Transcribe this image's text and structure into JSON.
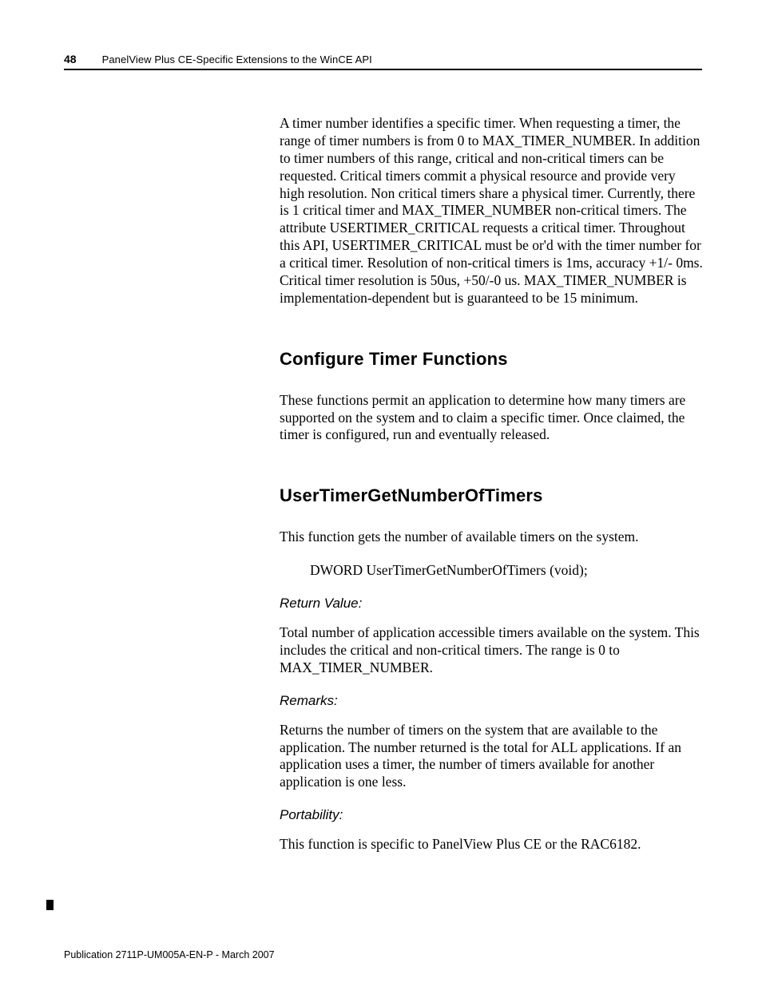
{
  "header": {
    "page_number": "48",
    "title": "PanelView Plus CE-Specific Extensions to the WinCE API"
  },
  "body": {
    "intro": "A timer number identifies a specific timer. When requesting a timer, the range of timer numbers is from 0 to MAX_TIMER_NUMBER. In addition to timer numbers of this range, critical and non-critical timers can be requested. Critical timers commit a physical resource and provide very high resolution. Non critical timers share a physical timer. Currently, there is 1 critical timer and MAX_TIMER_NUMBER non-critical timers. The attribute USERTIMER_CRITICAL requests a critical timer. Throughout this API, USERTIMER_CRITICAL must be or'd with the timer number for a critical timer. Resolution of non-critical timers is 1ms, accuracy +1/- 0ms. Critical timer resolution is 50us, +50/-0 us. MAX_TIMER_NUMBER is implementation-dependent but is guaranteed to be 15 minimum.",
    "s1": {
      "heading": "Configure Timer Functions",
      "para": "These functions permit an application to determine how many timers are supported on the system and to claim a specific timer. Once claimed, the timer is configured, run and eventually released."
    },
    "s2": {
      "heading": "UserTimerGetNumberOfTimers",
      "para1": "This function gets the number of available timers on the system.",
      "code": "DWORD UserTimerGetNumberOfTimers (void);",
      "rv_label": "Return Value:",
      "rv_text": "Total number of application accessible timers available on the system. This includes the critical and non-critical timers. The range is 0 to MAX_TIMER_NUMBER.",
      "rem_label": "Remarks:",
      "rem_text": "Returns the number of timers on the system that are available to the application. The number returned is the total for ALL applications. If an application uses a timer, the number of timers available for another application is one less.",
      "port_label": "Portability:",
      "port_text": "This function is specific to PanelView Plus CE or the RAC6182."
    }
  },
  "footer": "Publication 2711P-UM005A-EN-P - March 2007"
}
